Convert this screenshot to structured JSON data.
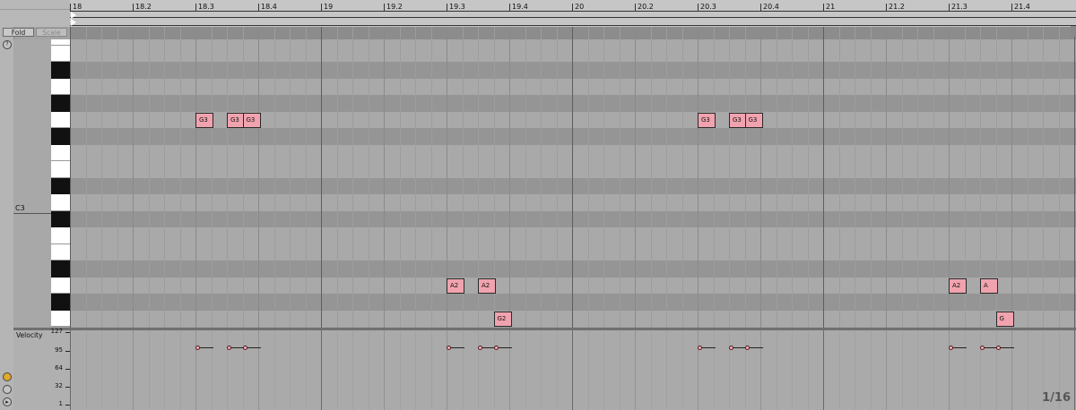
{
  "header": {
    "fold_label": "Fold",
    "scale_label": "Scale"
  },
  "ruler": {
    "labels": [
      "18",
      "18.2",
      "18.3",
      "18.4",
      "19",
      "19.2",
      "19.3",
      "19.4",
      "20",
      "20.2",
      "20.3",
      "20.4",
      "21",
      "21.2",
      "21.3",
      "21.4"
    ]
  },
  "keyboard": {
    "c3_label": "C3"
  },
  "notes": [
    {
      "pitch": "G3",
      "label": "G3",
      "start": 18.3
    },
    {
      "pitch": "G3",
      "label": "G3",
      "start": 18.3375
    },
    {
      "pitch": "G3",
      "label": "G3",
      "start": 18.375
    },
    {
      "pitch": "A2",
      "label": "A2",
      "start": 19.3
    },
    {
      "pitch": "A2",
      "label": "A2",
      "start": 19.3375
    },
    {
      "pitch": "G2",
      "label": "G2",
      "start": 19.375
    },
    {
      "pitch": "G3",
      "label": "G3",
      "start": 20.3
    },
    {
      "pitch": "G3",
      "label": "G3",
      "start": 20.3375
    },
    {
      "pitch": "G3",
      "label": "G3",
      "start": 20.375
    },
    {
      "pitch": "A2",
      "label": "A2",
      "start": 21.3
    },
    {
      "pitch": "A2",
      "label": "A",
      "start": 21.3375
    },
    {
      "pitch": "G2",
      "label": "G",
      "start": 21.375
    }
  ],
  "velocity": {
    "title": "Velocity",
    "ticks": [
      "127",
      "95",
      "64",
      "32",
      "1"
    ],
    "values": [
      100,
      100,
      100,
      100,
      100,
      100,
      100,
      100,
      100,
      100,
      100,
      100
    ]
  },
  "grid_resolution": "1/16",
  "colors": {
    "note_fill": "#f0a3ae",
    "background": "#a3a3a3"
  },
  "icons": [
    "fold-toggle-icon",
    "velocity-lock-icon",
    "preview-icon",
    "play-icon"
  ]
}
